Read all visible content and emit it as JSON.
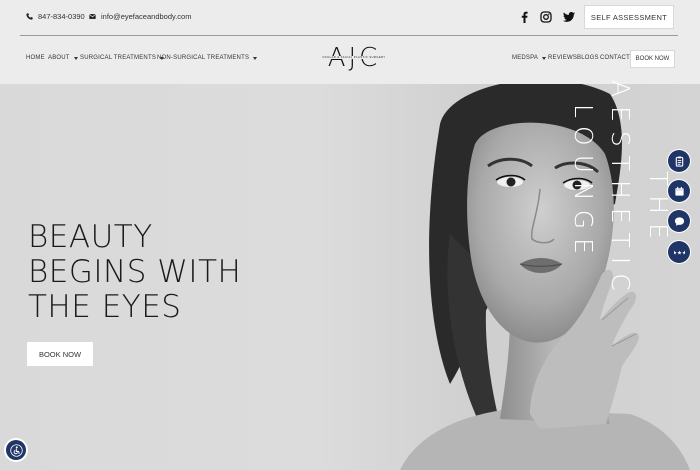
{
  "topbar": {
    "phone": "847-834-0390",
    "email": "info@eyefaceandbody.com",
    "icons": [
      "phone-icon",
      "mail-icon",
      "facebook-icon",
      "instagram-icon",
      "twitter-icon"
    ],
    "cta_label": "SELF ASSESSMENT"
  },
  "logo": {
    "mark": "AJC",
    "tagline": "OCULAR & FACIAL PLASTIC SURGERY"
  },
  "nav": {
    "left": [
      {
        "label": "HOME",
        "dropdown": false
      },
      {
        "label": "ABOUT",
        "dropdown": true
      },
      {
        "label": "SURGICAL TREATMENTS",
        "dropdown": true
      },
      {
        "label": "NON-SURGICAL TREATMENTS",
        "dropdown": true
      }
    ],
    "right": [
      {
        "label": "MEDSPA",
        "dropdown": true
      },
      {
        "label": "REVIEWS",
        "dropdown": false
      },
      {
        "label": "BLOGS",
        "dropdown": false
      },
      {
        "label": "CONTACT",
        "dropdown": false
      }
    ],
    "book_label": "BOOK NOW"
  },
  "hero": {
    "headline_lines": [
      "BEAUTY",
      "BEGINS WITH",
      "THE EYES"
    ],
    "button_label": "BOOK NOW",
    "vertical_text": {
      "the": "THE",
      "aesthetic": "AESTHETIC",
      "lounge": "LOUNGE"
    }
  },
  "side_buttons": [
    "clipboard-icon",
    "calendar-icon",
    "chat-icon",
    "rating-stars-icon"
  ],
  "accessibility_icon": "accessibility-icon",
  "colors": {
    "background": "#ececec",
    "accent_navy": "#1f3566",
    "text_dark": "#1a1a1a"
  }
}
